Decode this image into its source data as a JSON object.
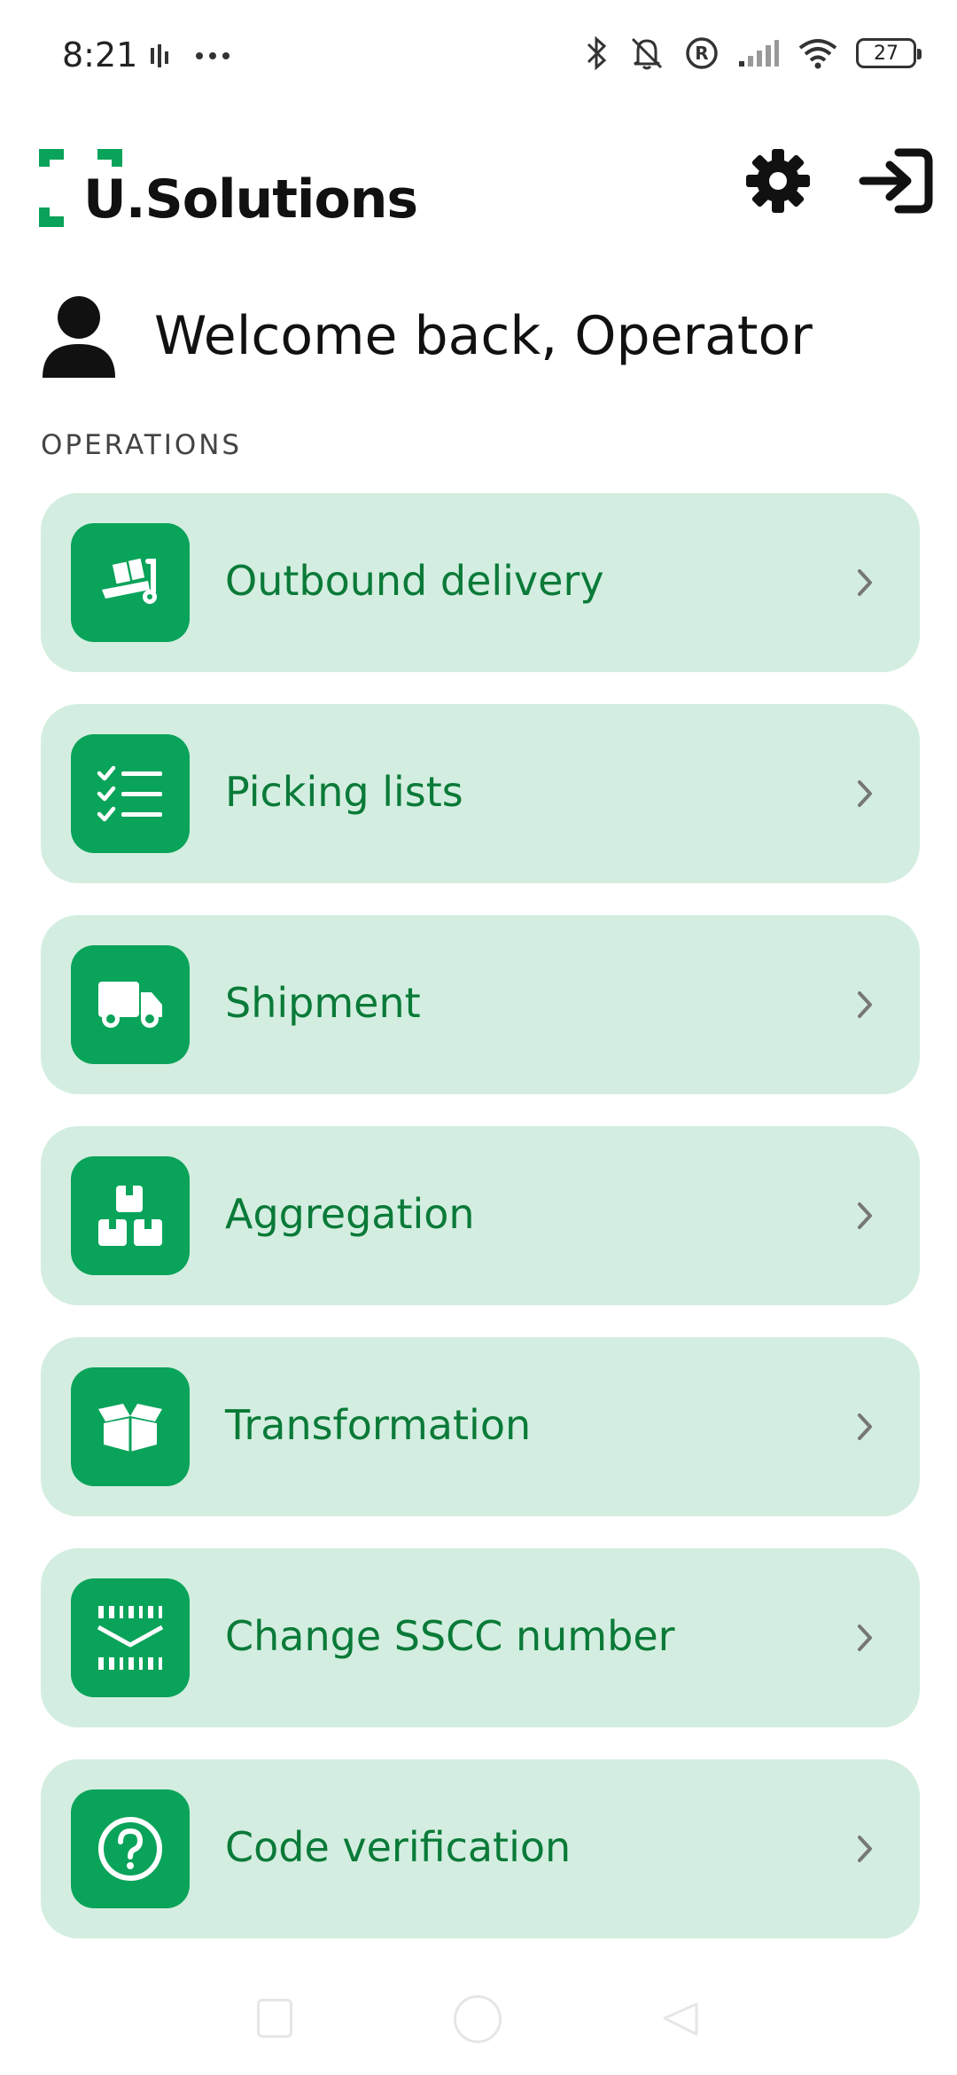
{
  "status_bar": {
    "time": "8:21",
    "battery": "27"
  },
  "header": {
    "brand": "U.Solutions",
    "brand_color": "#0aa35a",
    "settings_icon": "gear-icon",
    "logout_icon": "logout-icon"
  },
  "welcome": {
    "text": "Welcome back, Operator",
    "icon": "user-icon"
  },
  "section": {
    "label": "OPERATIONS"
  },
  "menu": {
    "items": [
      {
        "label": "Outbound delivery",
        "icon": "hand-truck-icon"
      },
      {
        "label": "Picking lists",
        "icon": "checklist-icon"
      },
      {
        "label": "Shipment",
        "icon": "truck-icon"
      },
      {
        "label": "Aggregation",
        "icon": "boxes-icon"
      },
      {
        "label": "Transformation",
        "icon": "open-box-icon"
      },
      {
        "label": "Change SSCC number",
        "icon": "barcode-icon"
      },
      {
        "label": "Code verification",
        "icon": "question-icon"
      }
    ],
    "card_color": "#d3eee0",
    "icon_color": "#0aa35a",
    "text_color": "#0a7a38"
  }
}
